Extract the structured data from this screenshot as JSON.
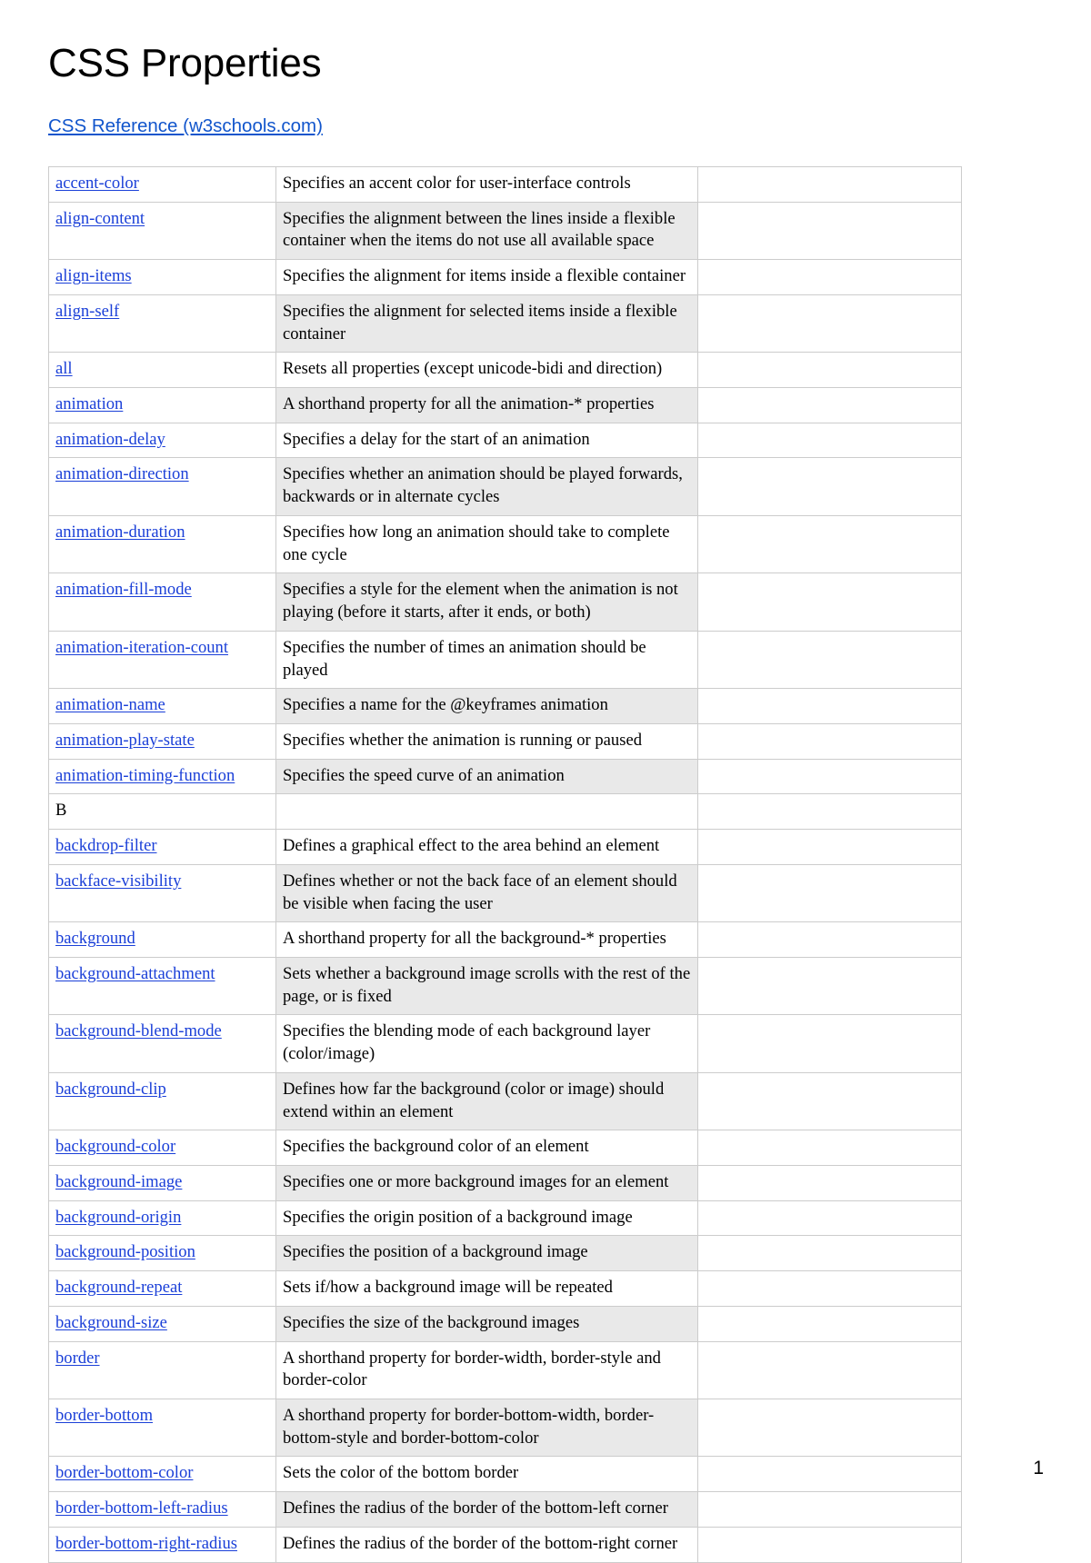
{
  "document": {
    "title": "CSS Properties",
    "reference_link": "CSS Reference (w3schools.com)",
    "page_number": "1"
  },
  "colors": {
    "link": "#1a3fd8",
    "header_link": "#1155cc",
    "row_shade": "#e9e9e9",
    "border": "#cccccc",
    "text": "#000000"
  },
  "table": {
    "columns": 3,
    "rows": [
      {
        "type": "property",
        "name": "accent-color",
        "description": "Specifies an accent color for user-interface controls",
        "extra": "",
        "shaded": false
      },
      {
        "type": "property",
        "name": "align-content",
        "description": "Specifies the alignment between the lines inside a flexible container when the items do not use all available space",
        "extra": "",
        "shaded": true
      },
      {
        "type": "property",
        "name": "align-items",
        "description": "Specifies the alignment for items inside a flexible container",
        "extra": "",
        "shaded": false
      },
      {
        "type": "property",
        "name": "align-self",
        "description": "Specifies the alignment for selected items inside a flexible container",
        "extra": "",
        "shaded": true
      },
      {
        "type": "property",
        "name": "all",
        "description": "Resets all properties (except unicode-bidi and direction)",
        "extra": "",
        "shaded": false
      },
      {
        "type": "property",
        "name": "animation",
        "description": "A shorthand property for all the animation-* properties",
        "extra": "",
        "shaded": true
      },
      {
        "type": "property",
        "name": "animation-delay",
        "description": "Specifies a delay for the start of an animation",
        "extra": "",
        "shaded": false
      },
      {
        "type": "property",
        "name": "animation-direction",
        "description": "Specifies whether an animation should be played forwards, backwards or in alternate cycles",
        "extra": "",
        "shaded": true
      },
      {
        "type": "property",
        "name": "animation-duration",
        "description": "Specifies how long an animation should take to complete one cycle",
        "extra": "",
        "shaded": false
      },
      {
        "type": "property",
        "name": "animation-fill-mode",
        "description": "Specifies a style for the element when the animation is not playing (before it starts, after it ends, or both)",
        "extra": "",
        "shaded": true
      },
      {
        "type": "property",
        "name": "animation-iteration-count",
        "description": "Specifies the number of times an animation should be played",
        "extra": "",
        "shaded": false
      },
      {
        "type": "property",
        "name": "animation-name",
        "description": "Specifies a name for the @keyframes animation",
        "extra": "",
        "shaded": true
      },
      {
        "type": "property",
        "name": "animation-play-state",
        "description": "Specifies whether the animation is running or paused",
        "extra": "",
        "shaded": false
      },
      {
        "type": "property",
        "name": "animation-timing-function",
        "description": "Specifies the speed curve of an animation",
        "extra": "",
        "shaded": true
      },
      {
        "type": "section",
        "name": "B",
        "description": "",
        "extra": "",
        "shaded": false
      },
      {
        "type": "property",
        "name": "backdrop-filter",
        "description": "Defines a graphical effect to the area behind an element",
        "extra": "",
        "shaded": false
      },
      {
        "type": "property",
        "name": "backface-visibility",
        "description": "Defines whether or not the back face of an element should be visible when facing the user",
        "extra": "",
        "shaded": true
      },
      {
        "type": "property",
        "name": "background",
        "description": "A shorthand property for all the background-* properties",
        "extra": "",
        "shaded": false
      },
      {
        "type": "property",
        "name": "background-attachment",
        "description": "Sets whether a background image scrolls with the rest of the page, or is fixed",
        "extra": "",
        "shaded": true
      },
      {
        "type": "property",
        "name": "background-blend-mode",
        "description": "Specifies the blending mode of each background layer (color/image)",
        "extra": "",
        "shaded": false
      },
      {
        "type": "property",
        "name": "background-clip",
        "description": "Defines how far the background (color or image) should extend within an element",
        "extra": "",
        "shaded": true
      },
      {
        "type": "property",
        "name": "background-color",
        "description": "Specifies the background color of an element",
        "extra": "",
        "shaded": false
      },
      {
        "type": "property",
        "name": "background-image",
        "description": "Specifies one or more background images for an element",
        "extra": "",
        "shaded": true
      },
      {
        "type": "property",
        "name": "background-origin",
        "description": "Specifies the origin position of a background image",
        "extra": "",
        "shaded": false
      },
      {
        "type": "property",
        "name": "background-position",
        "description": "Specifies the position of a background image",
        "extra": "",
        "shaded": true
      },
      {
        "type": "property",
        "name": "background-repeat",
        "description": "Sets if/how a background image will be repeated",
        "extra": "",
        "shaded": false
      },
      {
        "type": "property",
        "name": "background-size",
        "description": "Specifies the size of the background images",
        "extra": "",
        "shaded": true
      },
      {
        "type": "property",
        "name": "border",
        "description": "A shorthand property for border-width, border-style and border-color",
        "extra": "",
        "shaded": false
      },
      {
        "type": "property",
        "name": "border-bottom",
        "description": "A shorthand property for border-bottom-width, border-bottom-style and border-bottom-color",
        "extra": "",
        "shaded": true
      },
      {
        "type": "property",
        "name": "border-bottom-color",
        "description": "Sets the color of the bottom border",
        "extra": "",
        "shaded": false
      },
      {
        "type": "property",
        "name": "border-bottom-left-radius",
        "description": "Defines the radius of the border of the bottom-left corner",
        "extra": "",
        "shaded": true
      },
      {
        "type": "property",
        "name": "border-bottom-right-radius",
        "description": "Defines the radius of the border of the bottom-right corner",
        "extra": "",
        "shaded": false
      }
    ]
  }
}
